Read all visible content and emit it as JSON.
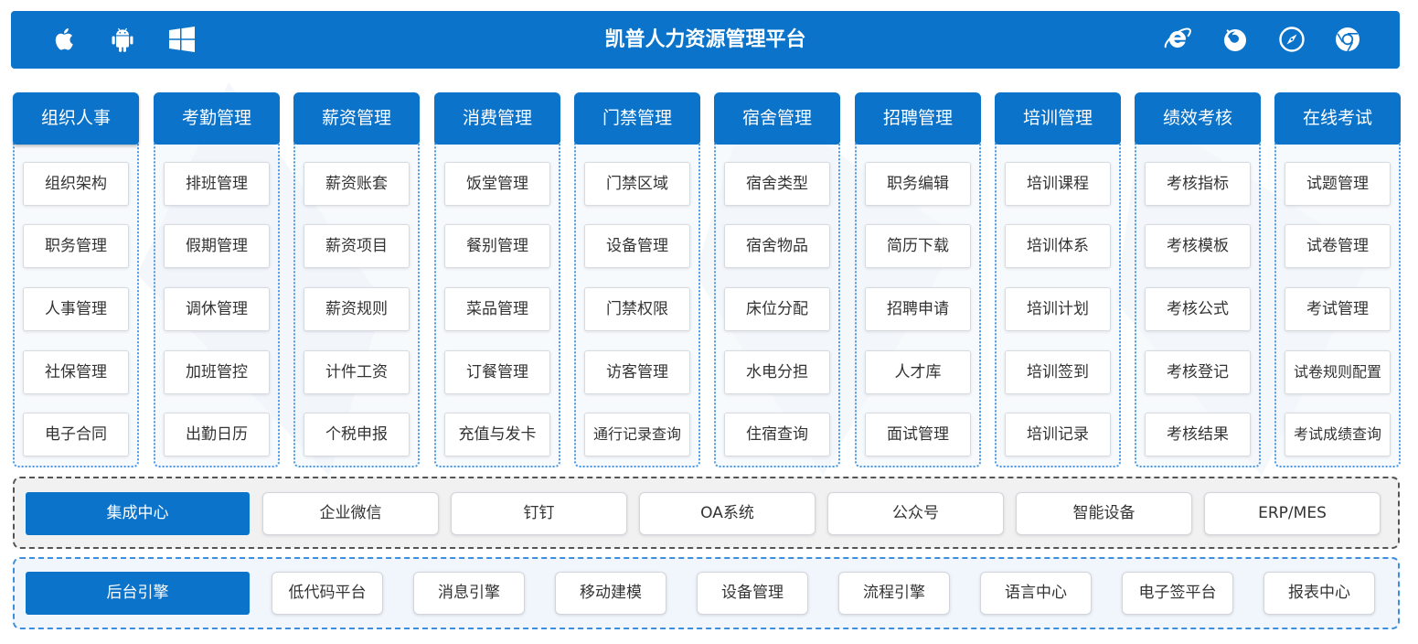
{
  "header": {
    "title": "凯普人力资源管理平台",
    "left_icons": [
      "apple-icon",
      "android-icon",
      "windows-icon"
    ],
    "right_icons": [
      "ie-icon",
      "firefox-icon",
      "safari-icon",
      "chrome-icon"
    ],
    "color": "#0b73c9"
  },
  "modules": [
    {
      "title": "组织人事",
      "items": [
        "组织架构",
        "职务管理",
        "人事管理",
        "社保管理",
        "电子合同"
      ]
    },
    {
      "title": "考勤管理",
      "items": [
        "排班管理",
        "假期管理",
        "调休管理",
        "加班管控",
        "出勤日历"
      ]
    },
    {
      "title": "薪资管理",
      "items": [
        "薪资账套",
        "薪资项目",
        "薪资规则",
        "计件工资",
        "个税申报"
      ]
    },
    {
      "title": "消费管理",
      "items": [
        "饭堂管理",
        "餐别管理",
        "菜品管理",
        "订餐管理",
        "充值与发卡"
      ]
    },
    {
      "title": "门禁管理",
      "items": [
        "门禁区域",
        "设备管理",
        "门禁权限",
        "访客管理",
        "通行记录查询"
      ]
    },
    {
      "title": "宿舍管理",
      "items": [
        "宿舍类型",
        "宿舍物品",
        "床位分配",
        "水电分担",
        "住宿查询"
      ]
    },
    {
      "title": "招聘管理",
      "items": [
        "职务编辑",
        "简历下载",
        "招聘申请",
        "人才库",
        "面试管理"
      ]
    },
    {
      "title": "培训管理",
      "items": [
        "培训课程",
        "培训体系",
        "培训计划",
        "培训签到",
        "培训记录"
      ]
    },
    {
      "title": "绩效考核",
      "items": [
        "考核指标",
        "考核模板",
        "考核公式",
        "考核登记",
        "考核结果"
      ]
    },
    {
      "title": "在线考试",
      "items": [
        "试题管理",
        "试卷管理",
        "考试管理",
        "试卷规则配置",
        "考试成绩查询"
      ]
    }
  ],
  "integration": {
    "title": "集成中心",
    "items": [
      "企业微信",
      "钉钉",
      "OA系统",
      "公众号",
      "智能设备",
      "ERP/MES"
    ]
  },
  "engine": {
    "title": "后台引擎",
    "items": [
      "低代码平台",
      "消息引擎",
      "移动建模",
      "设备管理",
      "流程引擎",
      "语言中心",
      "电子签平台",
      "报表中心"
    ]
  }
}
